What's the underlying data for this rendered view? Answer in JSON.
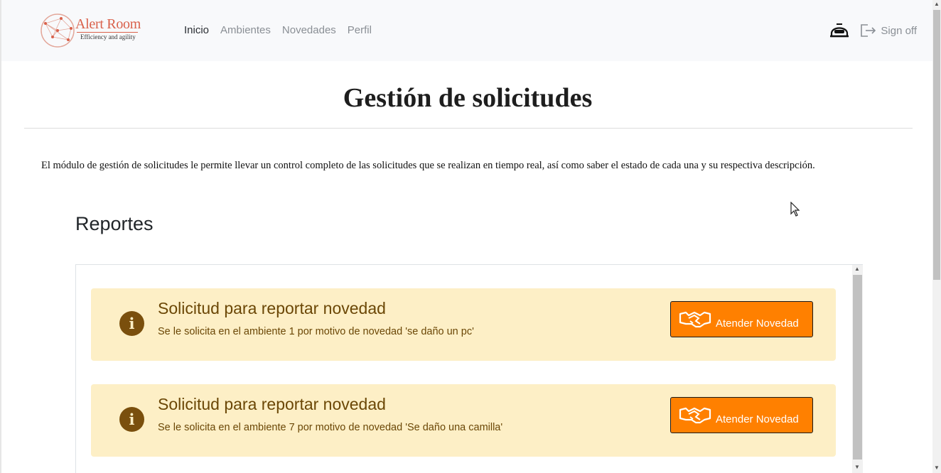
{
  "brand": {
    "name": "Alert Room",
    "tagline": "Efficiency and agility"
  },
  "nav": {
    "items": [
      {
        "label": "Inicio",
        "active": true
      },
      {
        "label": "Ambientes",
        "active": false
      },
      {
        "label": "Novedades",
        "active": false
      },
      {
        "label": "Perfil",
        "active": false
      }
    ],
    "signoff_label": "Sign off",
    "user_icon": "helmet-icon",
    "signoff_icon": "sign-out-icon"
  },
  "header": {
    "title": "Gestión de solicitudes",
    "description": "El módulo de gestión de solicitudes le permite llevar un control completo de las solicitudes que se realizan en tiempo real, así como saber el estado de cada una y su respectiva descripción."
  },
  "reports": {
    "title": "Reportes",
    "items": [
      {
        "title": "Solicitud para reportar novedad",
        "text": "Se le solicita en el ambiente 1 por motivo de novedad 'se daño un pc'",
        "button_label": "Atender Novedad",
        "icon": "info-icon"
      },
      {
        "title": "Solicitud para reportar novedad",
        "text": "Se le solicita en el ambiente 7 por motivo de novedad 'Se daño una camilla'",
        "button_label": "Atender Novedad",
        "icon": "info-icon"
      }
    ]
  },
  "colors": {
    "accent": "#ff8000",
    "card_bg": "#fdefc6",
    "card_text": "#6b4706",
    "brand": "#d9614b"
  }
}
